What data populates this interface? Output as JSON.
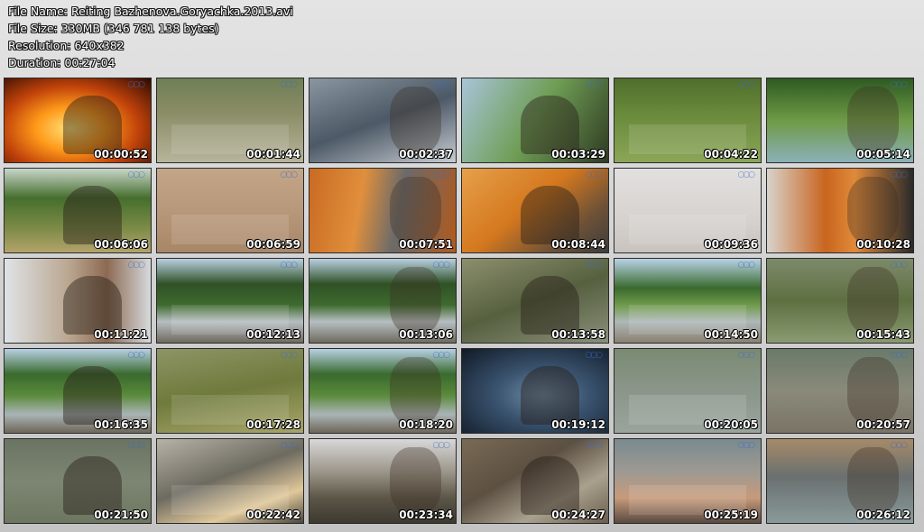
{
  "header": {
    "file_name": "File Name: Reiting Bazhenova.Goryachka.2013.avi",
    "file_size": "File Size: 330MB (346 781 138 bytes)",
    "resolution": "Resolution: 640x382",
    "duration": "Duration: 00:27:04"
  },
  "overlay_logo_icon": "olympic-rings-icon",
  "thumbnails": [
    {
      "time": "00:00:52",
      "bg": "radial-gradient(ellipse at 45% 60%, #ffe27a 0%, #ff9a1a 30%, #c0420a 60%, #2a0a02 100%)"
    },
    {
      "time": "00:01:44",
      "bg": "linear-gradient(180deg, #6f7f55 0%, #8a8c66 40%, #b7b49a 100%)"
    },
    {
      "time": "00:02:37",
      "bg": "linear-gradient(160deg, #8a96a0 0%, #4c5966 50%, #c7ccd2 100%)"
    },
    {
      "time": "00:03:29",
      "bg": "linear-gradient(120deg, #a7c4d9 0%, #6f9e55 50%, #2f3a22 100%)"
    },
    {
      "time": "00:04:22",
      "bg": "linear-gradient(180deg, #4f6e2c 0%, #6b8b3c 45%, #8aa657 100%)"
    },
    {
      "time": "00:05:14",
      "bg": "linear-gradient(180deg, #2e5a22 0%, #6e9a46 50%, #8bb0b8 100%)"
    },
    {
      "time": "00:06:06",
      "bg": "linear-gradient(180deg, #c8d6c9 0%, #466e2e 35%, #7a8a45 70%, #b3a36a 100%)"
    },
    {
      "time": "00:06:59",
      "bg": "linear-gradient(180deg, #c3a587 0%, #b8987a 50%, #a88668 100%)"
    },
    {
      "time": "00:07:51",
      "bg": "linear-gradient(100deg, #c96a22 0%, #e08f3c 35%, #6b6a6a 60%, #b05a1e 100%)"
    },
    {
      "time": "00:08:44",
      "bg": "linear-gradient(140deg, #e6a04a 0%, #d4781e 45%, #6f5236 75%, #3c3c3c 100%)"
    },
    {
      "time": "00:09:36",
      "bg": "linear-gradient(180deg, #e2e0df 0%, #d6d2cf 60%, #c9c3be 100%)"
    },
    {
      "time": "00:10:28",
      "bg": "linear-gradient(90deg, #d8d2cb 0%, #c9651e 40%, #e08a3a 60%, #2a2a2a 100%)"
    },
    {
      "time": "00:11:21",
      "bg": "linear-gradient(90deg, #dfe3e6 0%, #b9a58e 45%, #8c6a52 70%, #d6dadd 100%)"
    },
    {
      "time": "00:12:13",
      "bg": "linear-gradient(180deg, #b9cfe0 0%, #2f5226 30%, #3e6a2e 55%, #b7bec2 75%, #6e6a5e 100%)"
    },
    {
      "time": "00:13:06",
      "bg": "linear-gradient(180deg, #b9cfe0 0%, #2f5226 30%, #3e6a2e 55%, #b7bec2 75%, #6e6a5e 100%)"
    },
    {
      "time": "00:13:58",
      "bg": "linear-gradient(160deg, #8d8f6e 0%, #56603f 50%, #8a8f7a 100%)"
    },
    {
      "time": "00:14:50",
      "bg": "linear-gradient(180deg, #b8d2e6 0%, #3a6a2e 35%, #6f9a4a 55%, #aeb8b8 75%, #8a8070 100%)"
    },
    {
      "time": "00:15:43",
      "bg": "linear-gradient(180deg, #7d8a6a 0%, #5e7042 50%, #8a9a72 100%)"
    },
    {
      "time": "00:16:35",
      "bg": "linear-gradient(180deg, #b8d0e4 0%, #3a6a2e 30%, #5a8a3a 55%, #aab4b6 78%, #6e6658 100%)"
    },
    {
      "time": "00:17:28",
      "bg": "linear-gradient(170deg, #8e9466 0%, #6f7a3c 50%, #a9a66a 100%)"
    },
    {
      "time": "00:18:20",
      "bg": "linear-gradient(180deg, #b8d0e4 0%, #3a6a2e 30%, #5a8a3a 55%, #aab4b6 78%, #6e6658 100%)"
    },
    {
      "time": "00:19:12",
      "bg": "radial-gradient(ellipse at 55% 55%, #6f8ea8 0%, #3b5470 40%, #101a26 100%)"
    },
    {
      "time": "00:20:05",
      "bg": "linear-gradient(180deg, #7a8a72 0%, #8a968a 50%, #9aa49c 100%)"
    },
    {
      "time": "00:20:57",
      "bg": "linear-gradient(180deg, #6a7a6a 0%, #8a8a7a 50%, #7a7466 100%)"
    },
    {
      "time": "00:21:50",
      "bg": "linear-gradient(180deg, #6a7462 0%, #7d8672 50%, #6c7660 100%)"
    },
    {
      "time": "00:22:42",
      "bg": "linear-gradient(160deg, #b7b2a6 0%, #6d6a60 45%, #e0c89a 75%, #4a463e 100%)"
    },
    {
      "time": "00:23:34",
      "bg": "linear-gradient(180deg, #d8d8d8 0%, #9a9488 40%, #5c5648 70%, #3e3a30 100%)"
    },
    {
      "time": "00:24:27",
      "bg": "linear-gradient(150deg, #7a6a54 0%, #5c5042 40%, #a9a08e 70%, #6a5e4c 100%)"
    },
    {
      "time": "00:25:19",
      "bg": "linear-gradient(180deg, #7a8a90 0%, #9e9a92 40%, #c79a7a 70%, #5a4a40 100%)"
    },
    {
      "time": "00:26:12",
      "bg": "linear-gradient(180deg, #a68a68 0%, #6a7070 45%, #8a9a9a 100%)"
    }
  ]
}
